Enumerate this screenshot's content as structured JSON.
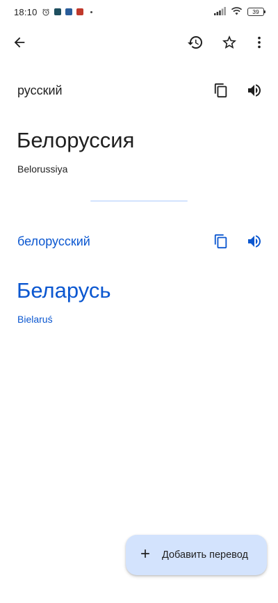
{
  "status_bar": {
    "time": "18:10",
    "battery": "39",
    "icons": [
      "alarm-icon",
      "app-notification-icon",
      "app-notification-icon",
      "app-notification-icon",
      "signal-icon",
      "wifi-icon",
      "battery-icon"
    ]
  },
  "app_bar": {
    "icons": [
      "back-arrow-icon",
      "history-icon",
      "star-icon",
      "more-vert-icon"
    ]
  },
  "source": {
    "language": "русский",
    "text": "Белоруссия",
    "transliteration": "Belorussiya"
  },
  "target": {
    "language": "белорусский",
    "text": "Беларусь",
    "transliteration": "Bielaruś"
  },
  "fab": {
    "label": "Добавить перевод",
    "icon": "plus-icon"
  },
  "colors": {
    "accent": "#0b57d0",
    "text": "#1f1f1f",
    "fab_bg": "#d3e3fd",
    "divider": "#d3e3fd"
  }
}
